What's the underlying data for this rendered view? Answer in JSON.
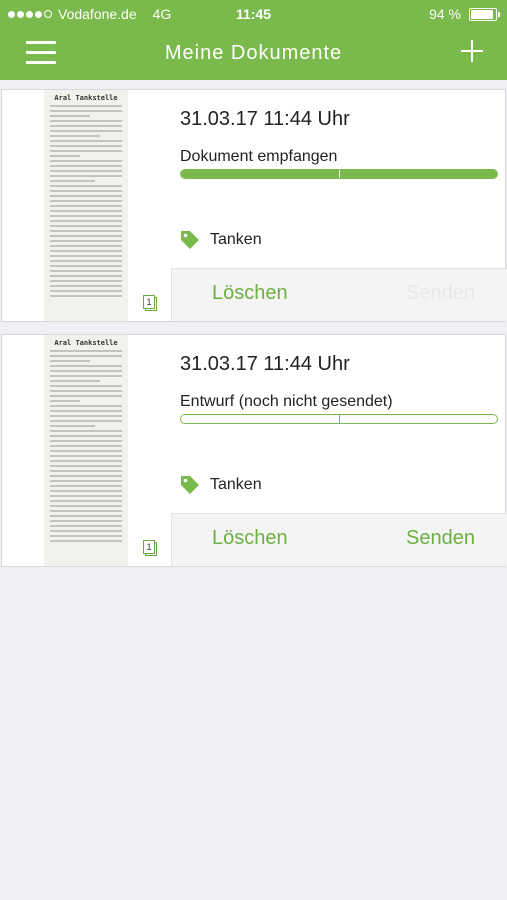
{
  "status_bar": {
    "carrier": "Vodafone.de",
    "network": "4G",
    "time": "11:45",
    "battery": "94 %",
    "battery_level": 0.94,
    "signal_bars": 4
  },
  "navbar": {
    "title": "Meine Dokumente",
    "menu_icon": "hamburger-icon",
    "add_icon": "plus-icon"
  },
  "colors": {
    "accent": "#7ab94c",
    "background": "#efeff4"
  },
  "documents": [
    {
      "date": "31.03.17 11:44 Uhr",
      "status": "Dokument empfangen",
      "progress": 1.0,
      "tag": "Tanken",
      "page_count": "1",
      "delete_label": "Löschen",
      "send_label": "Senden",
      "send_enabled": false,
      "receipt_header": "Aral Tankstelle"
    },
    {
      "date": "31.03.17 11:44 Uhr",
      "status": "Entwurf (noch nicht gesendet)",
      "progress": 0.0,
      "tag": "Tanken",
      "page_count": "1",
      "delete_label": "Löschen",
      "send_label": "Senden",
      "send_enabled": true,
      "receipt_header": "Aral Tankstelle"
    }
  ]
}
